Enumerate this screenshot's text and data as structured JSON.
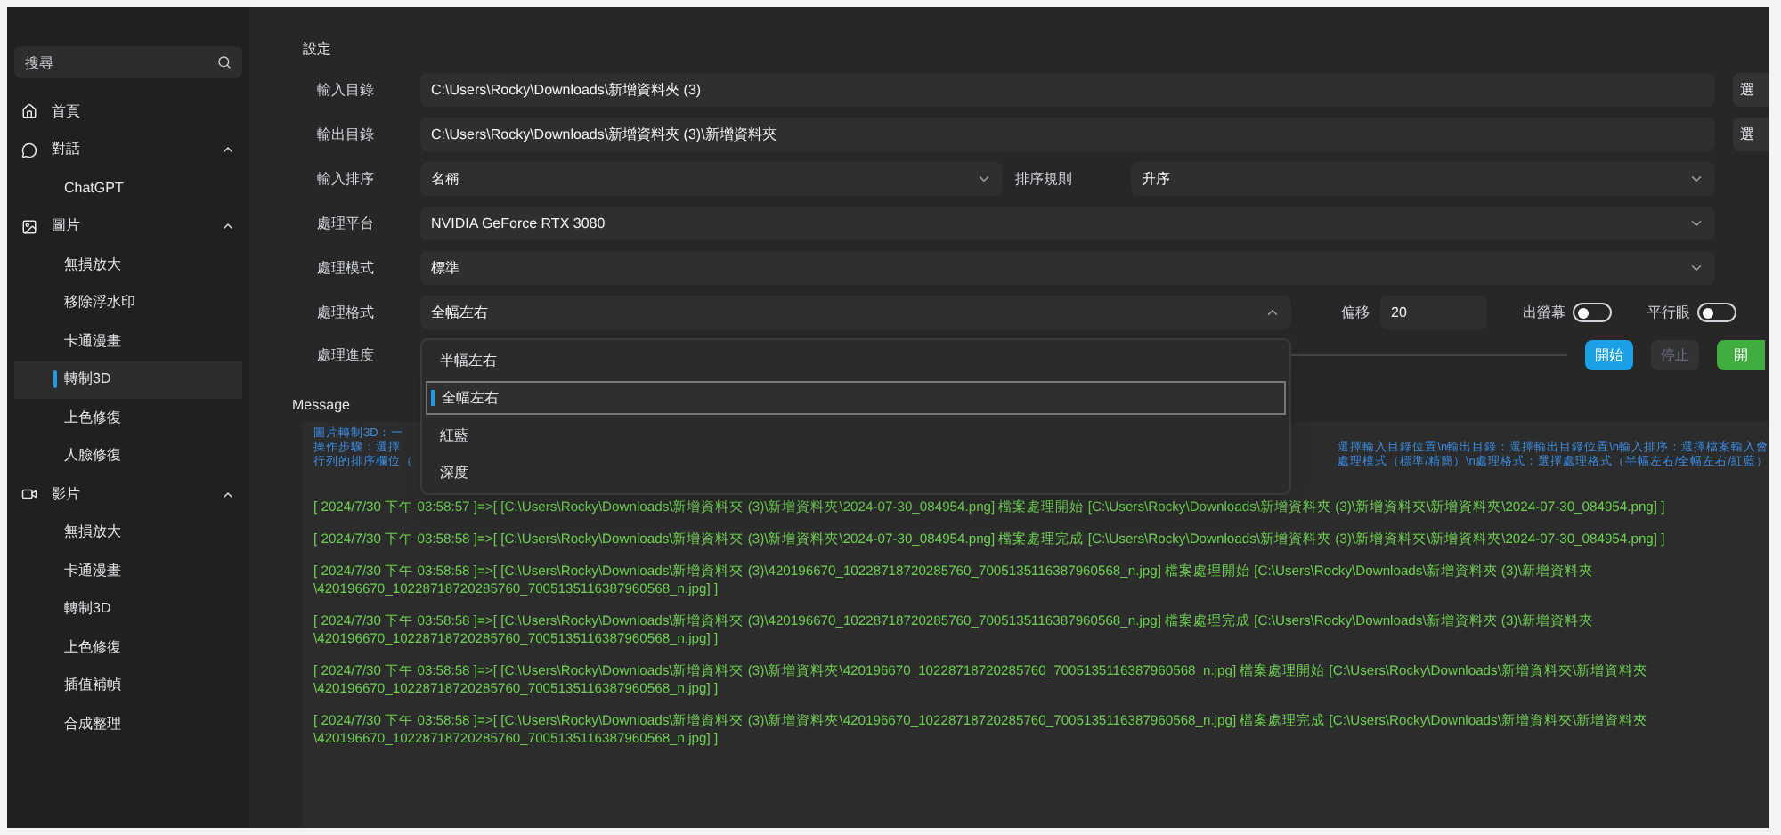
{
  "sidebar": {
    "search": {
      "placeholder": "搜尋"
    },
    "groups": [
      {
        "kind": "home",
        "label": "首頁"
      },
      {
        "kind": "chat",
        "label": "對話",
        "expanded": true,
        "items": [
          {
            "label": "ChatGPT",
            "selected": false
          }
        ]
      },
      {
        "kind": "image",
        "label": "圖片",
        "expanded": true,
        "items": [
          {
            "label": "無損放大",
            "selected": false
          },
          {
            "label": "移除浮水印",
            "selected": false
          },
          {
            "label": "卡通漫畫",
            "selected": false
          },
          {
            "label": "轉制3D",
            "selected": true
          },
          {
            "label": "上色修復",
            "selected": false
          },
          {
            "label": "人臉修復",
            "selected": false
          }
        ]
      },
      {
        "kind": "video",
        "label": "影片",
        "expanded": true,
        "items": [
          {
            "label": "無損放大",
            "selected": false
          },
          {
            "label": "卡通漫畫",
            "selected": false
          },
          {
            "label": "轉制3D",
            "selected": false
          },
          {
            "label": "上色修復",
            "selected": false
          },
          {
            "label": "插值補幀",
            "selected": false
          },
          {
            "label": "合成整理",
            "selected": false
          }
        ]
      }
    ]
  },
  "settings": {
    "title": "設定",
    "input_dir": {
      "label": "輸入目錄",
      "value": "C:\\Users\\Rocky\\Downloads\\新增資料夾 (3)",
      "button": "選"
    },
    "output_dir": {
      "label": "輸出目錄",
      "value": "C:\\Users\\Rocky\\Downloads\\新增資料夾 (3)\\新增資料夾",
      "button": "選"
    },
    "input_order": {
      "label": "輸入排序",
      "value": "名稱",
      "rule_label": "排序規則",
      "rule_value": "升序"
    },
    "platform": {
      "label": "處理平台",
      "value": "NVIDIA GeForce RTX 3080"
    },
    "mode": {
      "label": "處理模式",
      "value": "標準"
    },
    "format": {
      "label": "處理格式",
      "value": "全幅左右",
      "expanded": true,
      "options": [
        {
          "label": "半幅左右",
          "selected": false
        },
        {
          "label": "全幅左右",
          "selected": true
        },
        {
          "label": "紅藍",
          "selected": false
        },
        {
          "label": "深度",
          "selected": false
        }
      ]
    },
    "offset": {
      "label": "偏移",
      "value": "20"
    },
    "toggles": [
      {
        "label": "出螢幕",
        "on": false
      },
      {
        "label": "平行眼",
        "on": false
      }
    ],
    "progress": {
      "label": "處理進度"
    },
    "buttons": [
      {
        "kind": "primary",
        "label": "開始"
      },
      {
        "kind": "disabled",
        "label": "停止"
      },
      {
        "kind": "success",
        "label": "開"
      }
    ]
  },
  "message": {
    "title": "Message",
    "info": [
      {
        "left": "圖片轉制3D：一"
      },
      {
        "left": "操作步驟：選擇",
        "right": "選擇輸入目錄位置\\n輸出目錄：選擇輸出目錄位置\\n輸入排序：選擇檔案輸入會"
      },
      {
        "left": "行列的排序欄位（",
        "right": "處理模式（標準/精簡）\\n處理格式：選擇處理格式（半幅左右/全幅左右/紅藍）"
      }
    ],
    "logs": [
      {
        "lines": [
          "[ 2024/7/30 下午 03:58:57 ]=>[ [C:\\Users\\Rocky\\Downloads\\新增資料夾 (3)\\新增資料夾\\2024-07-30_084954.png] 檔案處理開始 [C:\\Users\\Rocky\\Downloads\\新增資料夾 (3)\\新增資料夾\\新增資料夾\\2024-07-30_084954.png] ]"
        ]
      },
      {
        "lines": [
          "[ 2024/7/30 下午 03:58:58 ]=>[ [C:\\Users\\Rocky\\Downloads\\新增資料夾 (3)\\新增資料夾\\2024-07-30_084954.png] 檔案處理完成 [C:\\Users\\Rocky\\Downloads\\新增資料夾 (3)\\新增資料夾\\新增資料夾\\2024-07-30_084954.png] ]"
        ]
      },
      {
        "lines": [
          "[ 2024/7/30 下午 03:58:58 ]=>[ [C:\\Users\\Rocky\\Downloads\\新增資料夾 (3)\\420196670_10228718720285760_7005135116387960568_n.jpg] 檔案處理開始 [C:\\Users\\Rocky\\Downloads\\新增資料夾 (3)\\新增資料夾",
          "\\420196670_10228718720285760_7005135116387960568_n.jpg] ]"
        ]
      },
      {
        "lines": [
          "[ 2024/7/30 下午 03:58:58 ]=>[ [C:\\Users\\Rocky\\Downloads\\新增資料夾 (3)\\420196670_10228718720285760_7005135116387960568_n.jpg] 檔案處理完成 [C:\\Users\\Rocky\\Downloads\\新增資料夾 (3)\\新增資料夾",
          "\\420196670_10228718720285760_7005135116387960568_n.jpg] ]"
        ]
      },
      {
        "lines": [
          "[ 2024/7/30 下午 03:58:58 ]=>[ [C:\\Users\\Rocky\\Downloads\\新增資料夾 (3)\\新增資料夾\\420196670_10228718720285760_7005135116387960568_n.jpg] 檔案處理開始 [C:\\Users\\Rocky\\Downloads\\新增資料夾\\新增資料夾",
          "\\420196670_10228718720285760_7005135116387960568_n.jpg] ]"
        ]
      },
      {
        "lines": [
          "[ 2024/7/30 下午 03:58:58 ]=>[ [C:\\Users\\Rocky\\Downloads\\新增資料夾 (3)\\新增資料夾\\420196670_10228718720285760_7005135116387960568_n.jpg] 檔案處理完成 [C:\\Users\\Rocky\\Downloads\\新增資料夾\\新增資料夾",
          "\\420196670_10228718720285760_7005135116387960568_n.jpg] ]"
        ]
      }
    ]
  }
}
